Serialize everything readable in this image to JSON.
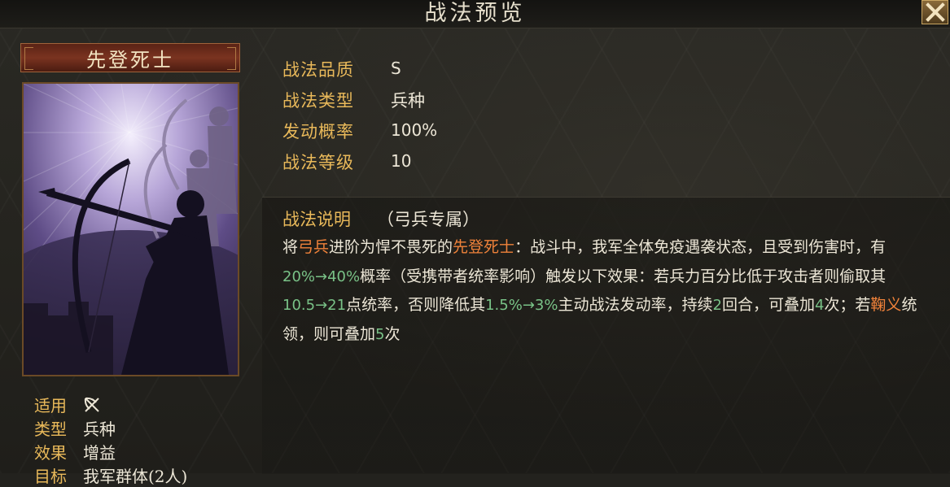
{
  "window": {
    "title": "战法预览",
    "close_label": "✕"
  },
  "skill": {
    "name": "先登死士",
    "stats": [
      {
        "label": "战法品质",
        "value": "S"
      },
      {
        "label": "战法类型",
        "value": "兵种"
      },
      {
        "label": "发动概率",
        "value": "100%"
      },
      {
        "label": "战法等级",
        "value": "10"
      }
    ],
    "meta": [
      {
        "label": "适用",
        "value": "",
        "icon": "crossed-bow-icon"
      },
      {
        "label": "类型",
        "value": "兵种"
      },
      {
        "label": "效果",
        "value": "增益"
      },
      {
        "label": "目标",
        "value": "我军群体(2人)"
      }
    ],
    "description": {
      "label": "战法说明",
      "tag": "（弓兵专属）",
      "segments": [
        {
          "text": "将",
          "style": "plain"
        },
        {
          "text": "弓兵",
          "style": "orange"
        },
        {
          "text": "进阶为悍不畏死的",
          "style": "plain"
        },
        {
          "text": "先登死士",
          "style": "orange"
        },
        {
          "text": "：战斗中，我军全体免疫遇袭状态，且受到伤害时，有",
          "style": "plain"
        },
        {
          "text": "20%→40%",
          "style": "green"
        },
        {
          "text": "概率（受携带者统率影响）触发以下效果：若兵力百分比低于攻击者则偷取其",
          "style": "plain"
        },
        {
          "text": "10.5→21",
          "style": "green"
        },
        {
          "text": "点统率，否则降低其",
          "style": "plain"
        },
        {
          "text": "1.5%→3%",
          "style": "green"
        },
        {
          "text": "主动战法发动率，持续",
          "style": "plain"
        },
        {
          "text": "2",
          "style": "green"
        },
        {
          "text": "回合，可叠加",
          "style": "plain"
        },
        {
          "text": "4",
          "style": "green"
        },
        {
          "text": "次；若",
          "style": "plain"
        },
        {
          "text": "鞠义",
          "style": "orange"
        },
        {
          "text": "统领，则可叠加",
          "style": "plain"
        },
        {
          "text": "5",
          "style": "green"
        },
        {
          "text": "次",
          "style": "plain"
        }
      ]
    }
  },
  "colors": {
    "label_gold": "#e9b95a",
    "highlight_orange": "#f0823a",
    "highlight_green": "#79c287",
    "banner_red": "#7a3320"
  }
}
